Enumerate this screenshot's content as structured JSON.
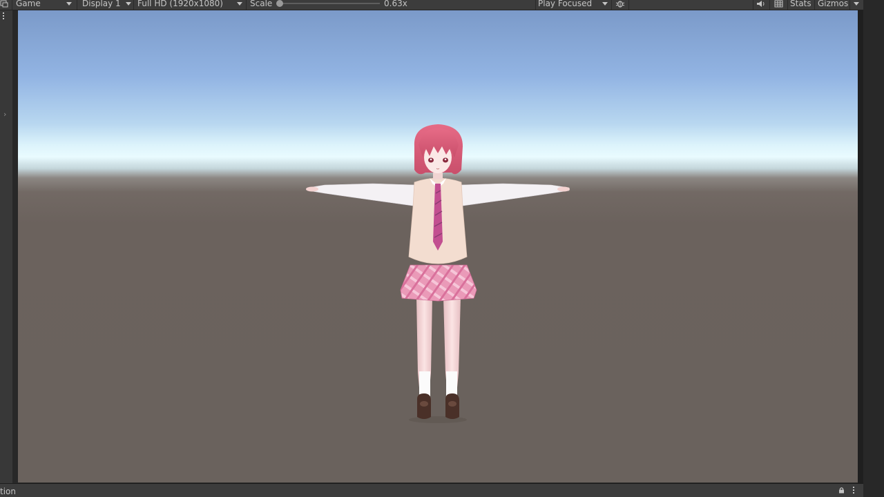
{
  "toolbar": {
    "view_dropdown": "Game",
    "display_dropdown": "Display 1",
    "resolution_dropdown": "Full HD (1920x1080)",
    "scale_label": "Scale",
    "scale_value": "0.63x",
    "scale_fraction": 0.0,
    "play_mode_dropdown": "Play Focused",
    "stats_label": "Stats",
    "gizmos_label": "Gizmos"
  },
  "icons": {
    "top_left": "maximize-icon",
    "bug": "bug-icon",
    "audio": "speaker-icon",
    "layout": "grid-icon",
    "gizmos_menu": "chevron-down-icon",
    "gutter_chevron": "chevron-right-icon",
    "lock": "lock-icon",
    "more": "kebab-menu-icon"
  },
  "bottom_bar": {
    "text": "tion"
  },
  "colors": {
    "toolbar_bg": "#3c3c3c",
    "sky_top": "#7b9ac9",
    "horizon": "#e9fbff",
    "ground": "#6a625d",
    "hair": "#e0607e",
    "tie": "#c0508f",
    "vest": "#f3ddd0",
    "skirt": "#e993b3"
  }
}
